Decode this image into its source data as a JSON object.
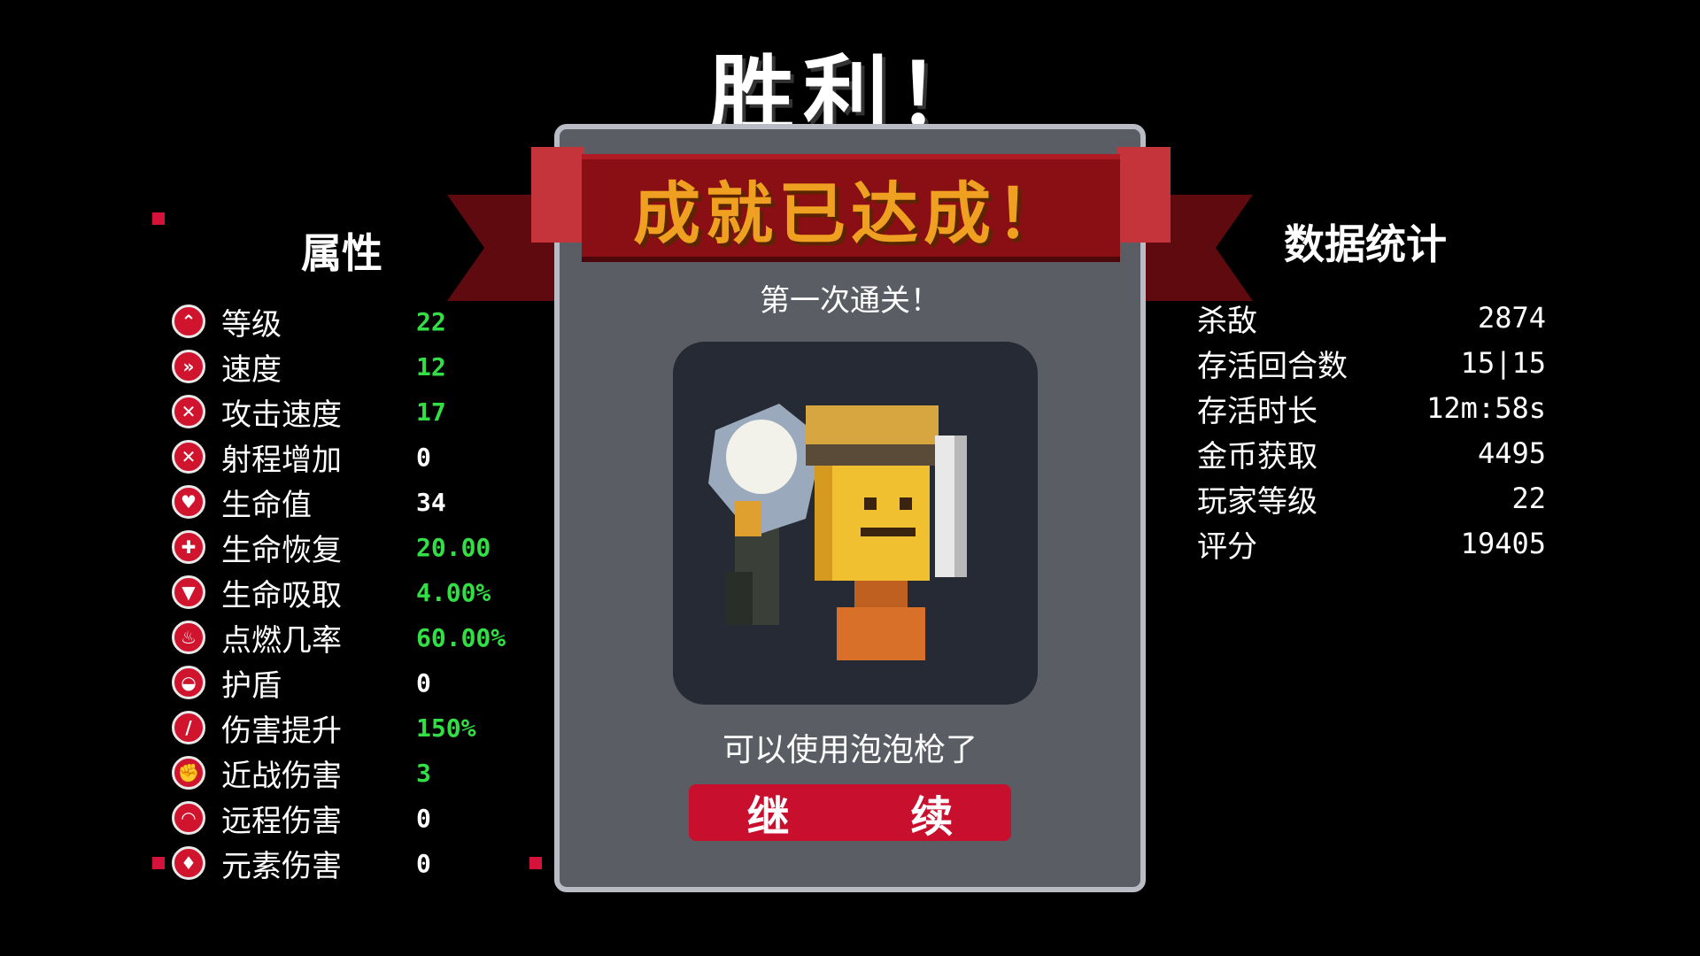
{
  "title": "胜利！",
  "banner": "成就已达成！",
  "achievement": {
    "subtitle": "第一次通关！",
    "description": "可以使用泡泡枪了",
    "continue_label": "继 续"
  },
  "attributes": {
    "title": "属性",
    "items": [
      {
        "label": "等级",
        "value": "22",
        "icon": "level-icon"
      },
      {
        "label": "速度",
        "value": "12",
        "icon": "speed-icon"
      },
      {
        "label": "攻击速度",
        "value": "17",
        "icon": "attack-speed-icon"
      },
      {
        "label": "射程增加",
        "value": "0",
        "icon": "range-icon"
      },
      {
        "label": "生命值",
        "value": "34",
        "icon": "heart-icon"
      },
      {
        "label": "生命恢复",
        "value": "20.00",
        "icon": "regen-icon"
      },
      {
        "label": "生命吸取",
        "value": "4.00%",
        "icon": "lifesteal-icon"
      },
      {
        "label": "点燃几率",
        "value": "60.00%",
        "icon": "ignite-icon"
      },
      {
        "label": "护盾",
        "value": "0",
        "icon": "shield-icon"
      },
      {
        "label": "伤害提升",
        "value": "150%",
        "icon": "damage-icon"
      },
      {
        "label": "近战伤害",
        "value": "3",
        "icon": "melee-icon"
      },
      {
        "label": "远程伤害",
        "value": "0",
        "icon": "ranged-icon"
      },
      {
        "label": "元素伤害",
        "value": "0",
        "icon": "elemental-icon"
      }
    ]
  },
  "statistics": {
    "title": "数据统计",
    "items": [
      {
        "label": "杀敌",
        "value": "2874"
      },
      {
        "label": "存活回合数",
        "value": "15|15"
      },
      {
        "label": "存活时长",
        "value": "12m:58s"
      },
      {
        "label": "金币获取",
        "value": "4495"
      },
      {
        "label": "玩家等级",
        "value": "22"
      },
      {
        "label": "评分",
        "value": "19405"
      }
    ]
  },
  "colors": {
    "positive": "#32e046",
    "neutral": "#ffffff",
    "accent_red": "#c8102e",
    "banner_text": "#f0a020"
  }
}
